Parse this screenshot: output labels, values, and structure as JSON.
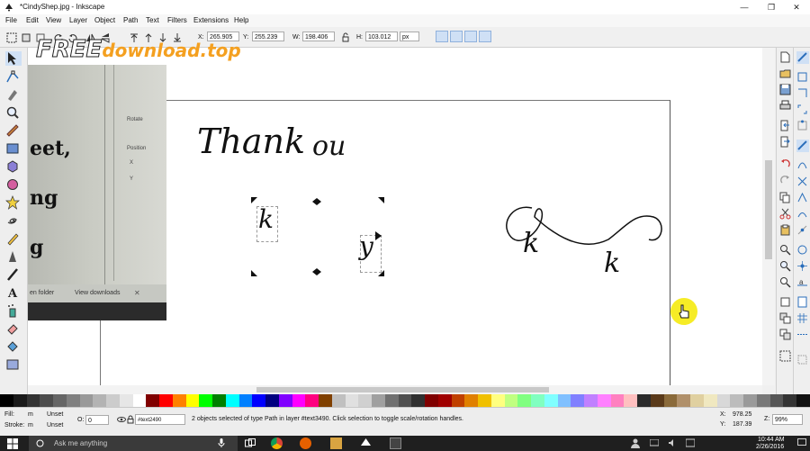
{
  "window": {
    "title": "*CindyShep.jpg - Inkscape",
    "controls": [
      "—",
      "❐",
      "✕"
    ]
  },
  "menu": [
    "File",
    "Edit",
    "View",
    "Layer",
    "Object",
    "Path",
    "Text",
    "Filters",
    "Extensions",
    "Help"
  ],
  "watermark": {
    "part1": "FREE",
    "part2": "download",
    "part3": ".top"
  },
  "controls": {
    "x_label": "X:",
    "x_value": "265.905",
    "y_label": "Y:",
    "y_value": "255.239",
    "w_label": "W:",
    "w_value": "198.406",
    "h_label": "H:",
    "h_value": "103.012",
    "unit": "px"
  },
  "canvas": {
    "thank_text": "Thank",
    "ou_text": "ou",
    "k_small": "k",
    "y_small": "y",
    "k_big_left": "k",
    "k_big_right": "k"
  },
  "overlay": {
    "text_line1": "eet,",
    "text_line2": "ng",
    "text_line3": "g",
    "rotate_label": "Rotate",
    "position_label": "Position",
    "x_char": "X",
    "y_char": "Y",
    "folder_button": "en folder",
    "downloads_button": "View downloads",
    "close": "✕"
  },
  "palette": [
    "#000000",
    "#1a1a1a",
    "#333333",
    "#4d4d4d",
    "#666666",
    "#808080",
    "#999999",
    "#b3b3b3",
    "#cccccc",
    "#e6e6e6",
    "#ffffff",
    "#800000",
    "#ff0000",
    "#ff8000",
    "#ffff00",
    "#00ff00",
    "#008000",
    "#00ffff",
    "#0080ff",
    "#0000ff",
    "#000080",
    "#8000ff",
    "#ff00ff",
    "#ff0080",
    "#804000",
    "#c0c0c0",
    "#e0e0e0",
    "#d0d0d0",
    "#a0a0a0",
    "#707070",
    "#505050",
    "#303030",
    "#800000",
    "#a00000",
    "#c04000",
    "#e08000",
    "#f0c000",
    "#ffff80",
    "#c0ff80",
    "#80ff80",
    "#80ffc0",
    "#80ffff",
    "#80c0ff",
    "#8080ff",
    "#c080ff",
    "#ff80ff",
    "#ff80c0",
    "#ffc0c0",
    "#2b2b2b",
    "#5a3a1a",
    "#8a6a3a",
    "#b0906a",
    "#e0d0a0",
    "#f0e8c0",
    "#d8d8d8",
    "#bcbcbc",
    "#9a9a9a",
    "#787878",
    "#565656",
    "#343434",
    "#121212"
  ],
  "status": {
    "fill_label": "Fill:",
    "fill_value": "m",
    "fill_unset": "Unset",
    "stroke_label": "Stroke:",
    "stroke_value": "m",
    "stroke_unset": "Unset",
    "opacity_label": "O:",
    "opacity_value": "0",
    "layer_name": "#text2490",
    "message": "2 objects selected of type Path in layer #text3490. Click selection to toggle scale/rotation handles.",
    "x_coord_label": "X:",
    "x_coord": "978.25",
    "y_coord_label": "Y:",
    "y_coord": "187.39",
    "zoom_label": "Z:",
    "zoom": "99%"
  },
  "taskbar": {
    "search_placeholder": "Ask me anything",
    "time": "10:44 AM",
    "date": "2/26/2016"
  },
  "colors": {
    "accent": "#2a6ebb",
    "cursor_highlight": "#f5e900",
    "taskbar": "#1f1f1f"
  }
}
